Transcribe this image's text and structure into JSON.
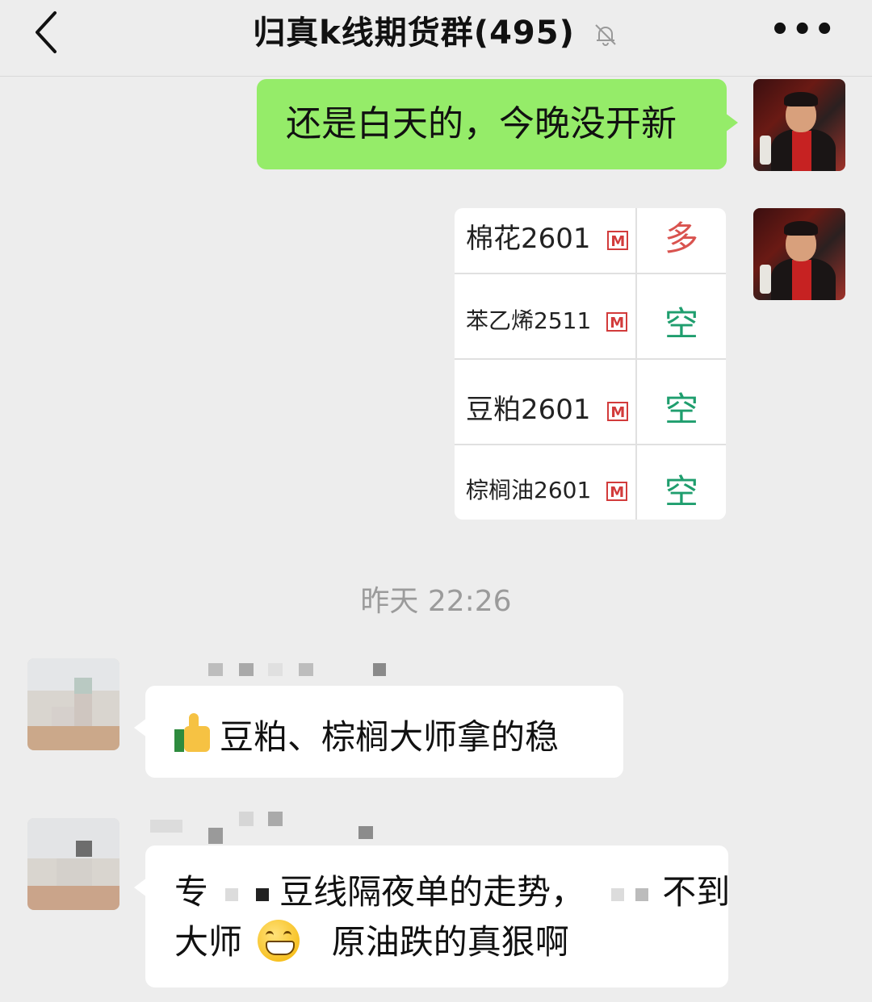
{
  "header": {
    "title": "归真k线期货群(495)",
    "back_icon": "chevron-left-icon",
    "mute_icon": "bell-off-icon",
    "more_label": "•••"
  },
  "messages": {
    "msg1": {
      "text": "还是白天的，今晚没开新"
    },
    "table": {
      "rows": [
        {
          "name": "棉花2601",
          "badge": "M",
          "direction": "多",
          "dir_color": "#d9534f"
        },
        {
          "name": "苯乙烯2511",
          "badge": "M",
          "direction": "空",
          "dir_color": "#1f9e6e"
        },
        {
          "name": "豆粕2601",
          "badge": "M",
          "direction": "空",
          "dir_color": "#1f9e6e"
        },
        {
          "name": "棕榈油2601",
          "badge": "M",
          "direction": "空",
          "dir_color": "#1f9e6e"
        }
      ]
    },
    "timestamp": "昨天 22:26",
    "msg3": {
      "text": "豆粕、棕榈大师拿的稳"
    },
    "msg4": {
      "line1_a": "专",
      "line1_b": "豆线隔夜单的走势，",
      "line1_c": "不到",
      "line2_a": "大师",
      "line2_b": "原油跌的真狠啊"
    }
  },
  "colors": {
    "background": "#ededed",
    "self_bubble": "#95ec69",
    "other_bubble": "#ffffff",
    "long_red": "#d9534f",
    "short_green": "#1f9e6e"
  }
}
